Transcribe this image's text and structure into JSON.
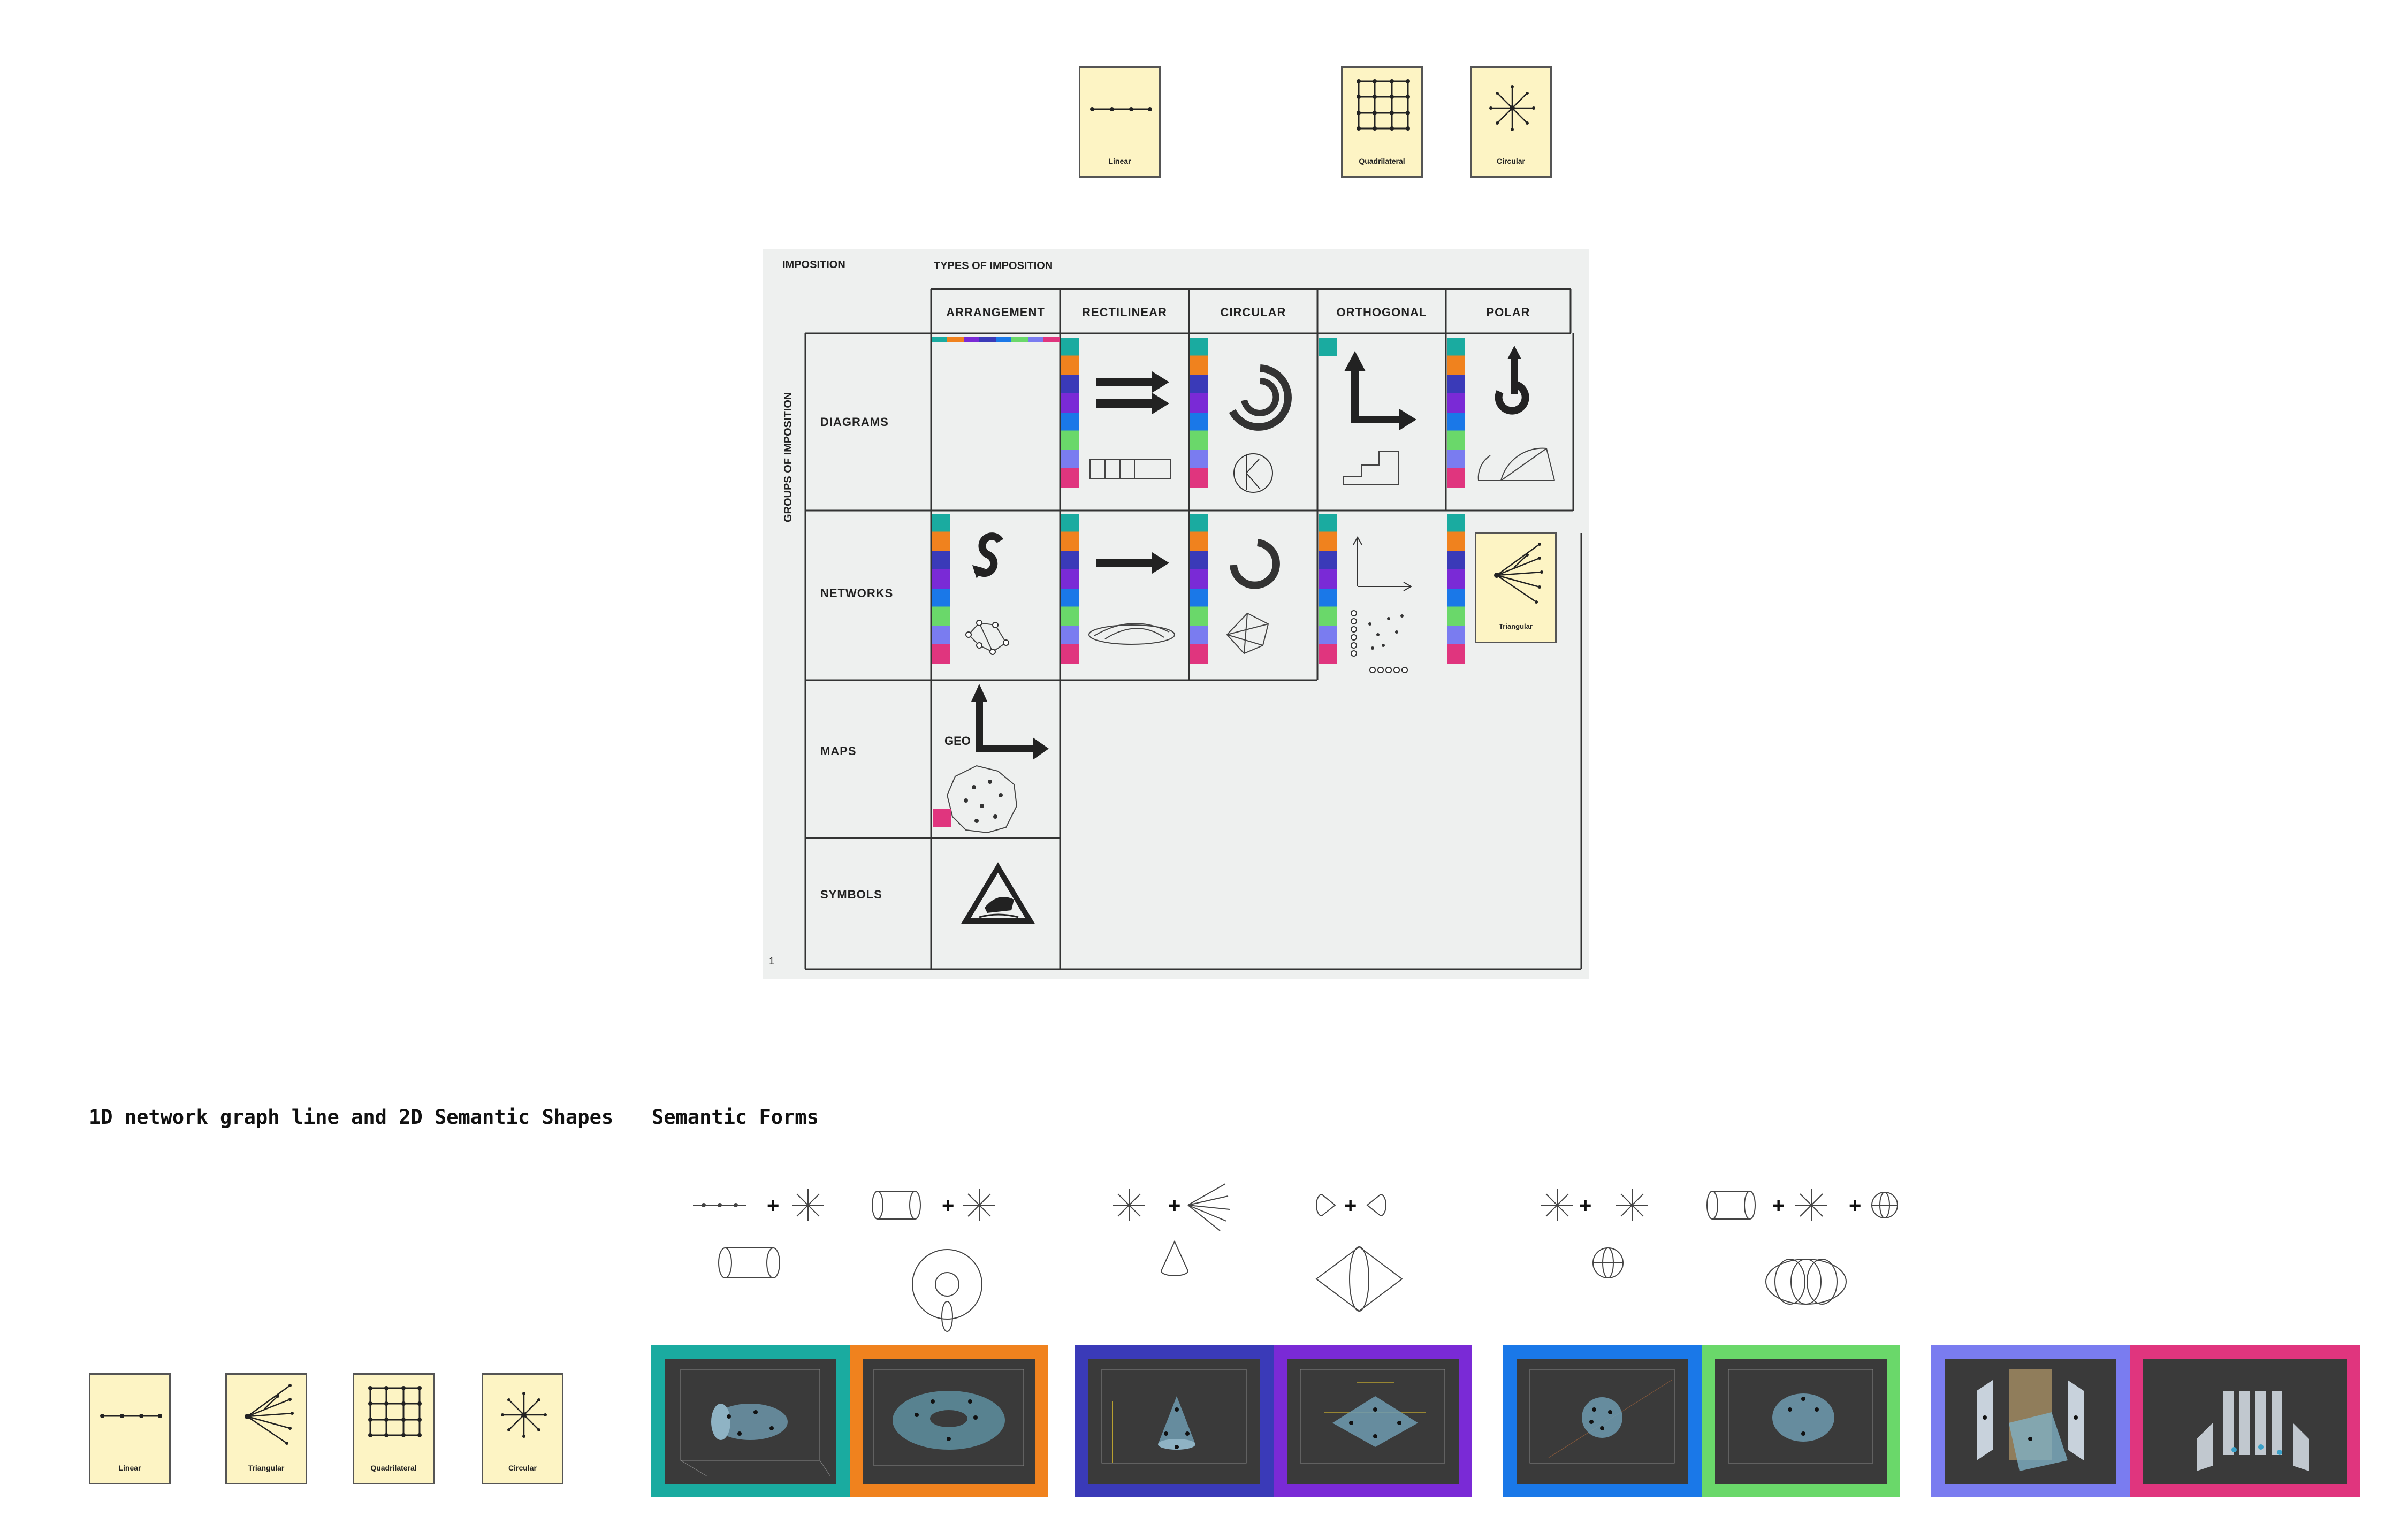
{
  "top_cards": [
    {
      "label": "Linear",
      "icon": "linear-icon"
    },
    {
      "label": "Quadrilateral",
      "icon": "quadrilateral-grid-icon"
    },
    {
      "label": "Circular",
      "icon": "circular-star-icon"
    }
  ],
  "figure": {
    "header_imposition": "IMPOSITION",
    "header_types": "TYPES OF IMPOSITION",
    "side_label": "GROUPS OF IMPOSITION",
    "columns": [
      "ARRANGEMENT",
      "RECTILINEAR",
      "CIRCULAR",
      "ORTHOGONAL",
      "POLAR"
    ],
    "rows": [
      "DIAGRAMS",
      "NETWORKS",
      "MAPS",
      "SYMBOLS"
    ],
    "geo_label": "GEO",
    "page_number": "1",
    "inset_card_label": "Triangular"
  },
  "sections": {
    "left_title": "1D network graph line and 2D Semantic Shapes",
    "right_title": "Semantic Forms"
  },
  "bottom_cards": [
    {
      "label": "Linear",
      "icon": "linear-icon"
    },
    {
      "label": "Triangular",
      "icon": "triangular-tree-icon"
    },
    {
      "label": "Quadrilateral",
      "icon": "quadrilateral-grid-icon"
    },
    {
      "label": "Circular",
      "icon": "circular-star-icon"
    }
  ],
  "colors": {
    "teal": "#1aaba0",
    "orange": "#f0821e",
    "indigo": "#3a3ab8",
    "purple": "#7a2ad6",
    "blue": "#1a78e8",
    "green": "#6ad86a",
    "lavender": "#7a7cf0",
    "magenta": "#e0357e",
    "card_fill": "#fdf4c4"
  },
  "screenshots": [
    {
      "border_color": "teal",
      "content": "cylinder-network-render"
    },
    {
      "border_color": "orange",
      "content": "torus-network-render"
    },
    {
      "border_color": "indigo",
      "content": "cone-network-render"
    },
    {
      "border_color": "purple",
      "content": "bicone-network-render"
    },
    {
      "border_color": "blue",
      "content": "sphere-network-render"
    },
    {
      "border_color": "green",
      "content": "spindle-network-render"
    },
    {
      "border_color": "lavender",
      "content": "planes-network-render"
    },
    {
      "border_color": "magenta",
      "content": "pillars-network-render"
    }
  ]
}
